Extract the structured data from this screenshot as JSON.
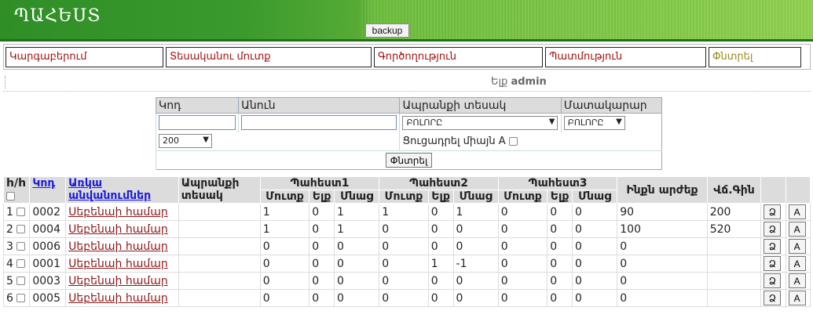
{
  "header": {
    "logo": "ՊԱՀԵՍՏ",
    "backup_label": "backup"
  },
  "nav": {
    "items": [
      {
        "label": "Կարգաբերում"
      },
      {
        "label": "Տեսականու մուտք"
      },
      {
        "label": "Գործողություն"
      },
      {
        "label": "Պատմություն"
      },
      {
        "label": "Փնտրել"
      }
    ]
  },
  "user": {
    "label": "Ելք",
    "name": "admin"
  },
  "filter": {
    "col_code": "Կոդ",
    "col_name": "Անուն",
    "col_type": "Ապրանքի տեսակ",
    "col_supplier": "Մատակարար",
    "type_value": "ԲՈԼՈՐԸ",
    "supplier_value": "ԲՈԼՈՐԸ",
    "limit_value": "200",
    "only_a_label": "Ցուցադրել միայն A",
    "search_label": "Փնտրել"
  },
  "results": {
    "headers": {
      "index": "h/h",
      "code": "Կոդ",
      "names": "Առկա անվանումներ",
      "type": "Ապրանքի տեսակ",
      "wh1": "Պահեստ1",
      "wh2": "Պահեստ2",
      "wh3": "Պահեստ3",
      "in": "Մուտք",
      "out": "Ելք",
      "rest": "Մնաց",
      "cost": "Ինքն արժեք",
      "price": "Վճ.Գին"
    },
    "rows": [
      {
        "n": "1",
        "code": "0002",
        "name": "Սեբենաի համար",
        "w1": [
          "1",
          "0",
          "1"
        ],
        "w2": [
          "1",
          "0",
          "1"
        ],
        "w3": [
          "0",
          "0",
          "0"
        ],
        "cost": "90",
        "price": "200"
      },
      {
        "n": "2",
        "code": "0004",
        "name": "Սեբենաի համար",
        "w1": [
          "1",
          "0",
          "1"
        ],
        "w2": [
          "0",
          "0",
          "0"
        ],
        "w3": [
          "0",
          "0",
          "0"
        ],
        "cost": "100",
        "price": "520"
      },
      {
        "n": "3",
        "code": "0006",
        "name": "Սեբենաի համար",
        "w1": [
          "0",
          "0",
          "0"
        ],
        "w2": [
          "0",
          "0",
          "0"
        ],
        "w3": [
          "0",
          "0",
          "0"
        ],
        "cost": "0",
        "price": ""
      },
      {
        "n": "4",
        "code": "0001",
        "name": "Սեբենաի համար",
        "w1": [
          "0",
          "0",
          "0"
        ],
        "w2": [
          "0",
          "1",
          "-1"
        ],
        "w3": [
          "0",
          "0",
          "0"
        ],
        "cost": "0",
        "price": ""
      },
      {
        "n": "5",
        "code": "0003",
        "name": "Սեբենաի համար",
        "w1": [
          "0",
          "0",
          "0"
        ],
        "w2": [
          "0",
          "0",
          "0"
        ],
        "w3": [
          "0",
          "0",
          "0"
        ],
        "cost": "0",
        "price": ""
      },
      {
        "n": "6",
        "code": "0005",
        "name": "Սեբենաի համար",
        "w1": [
          "0",
          "0",
          "0"
        ],
        "w2": [
          "0",
          "0",
          "0"
        ],
        "w3": [
          "0",
          "0",
          "0"
        ],
        "cost": "0",
        "price": ""
      }
    ],
    "edit_label": "Ձ",
    "a_label": "A"
  }
}
